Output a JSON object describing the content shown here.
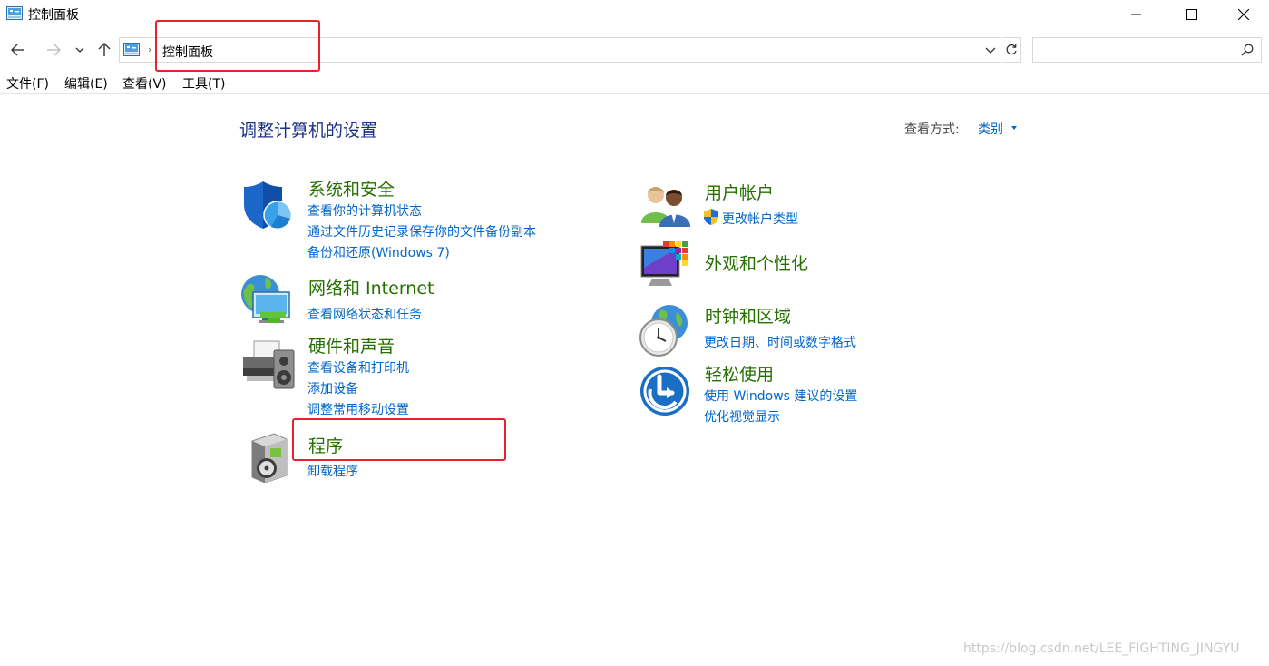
{
  "window": {
    "title": "控制面板",
    "minimize_icon": "minimize-icon",
    "maximize_icon": "maximize-icon",
    "close_icon": "close-icon"
  },
  "navigation": {
    "back_icon": "arrow-left-icon",
    "forward_icon": "arrow-right-icon",
    "recent_icon": "chevron-down-icon",
    "up_icon": "arrow-up-icon",
    "address_path": "控制面板",
    "address_separator": "›",
    "search_placeholder": ""
  },
  "menubar": {
    "items": [
      "文件(F)",
      "编辑(E)",
      "查看(V)",
      "工具(T)"
    ]
  },
  "content": {
    "page_title": "调整计算机的设置",
    "view_by_label": "查看方式:",
    "view_by_value": "类别",
    "categories": [
      {
        "title": "系统和安全",
        "icon": "shield-icon",
        "links": [
          "查看你的计算机状态",
          "通过文件历史记录保存你的文件备份副本",
          "备份和还原(Windows 7)"
        ]
      },
      {
        "title": "网络和 Internet",
        "icon": "network-globe-icon",
        "links": [
          "查看网络状态和任务"
        ]
      },
      {
        "title": "硬件和声音",
        "icon": "printer-speaker-icon",
        "links": [
          "查看设备和打印机",
          "添加设备",
          "调整常用移动设置"
        ]
      },
      {
        "title": "程序",
        "icon": "programs-disc-icon",
        "links": [
          "卸载程序"
        ]
      },
      {
        "title": "用户帐户",
        "icon": "users-icon",
        "links": [
          "更改帐户类型"
        ],
        "link_icon": "uac-shield-icon"
      },
      {
        "title": "外观和个性化",
        "icon": "monitor-palette-icon",
        "links": []
      },
      {
        "title": "时钟和区域",
        "icon": "clock-globe-icon",
        "links": [
          "更改日期、时间或数字格式"
        ]
      },
      {
        "title": "轻松使用",
        "icon": "ease-of-access-icon",
        "links": [
          "使用 Windows 建议的设置",
          "优化视觉显示"
        ]
      }
    ]
  },
  "annotations": {
    "highlight_color": "#e8202a"
  },
  "watermark": "https://blog.csdn.net/LEE_FIGHTING_JINGYU"
}
